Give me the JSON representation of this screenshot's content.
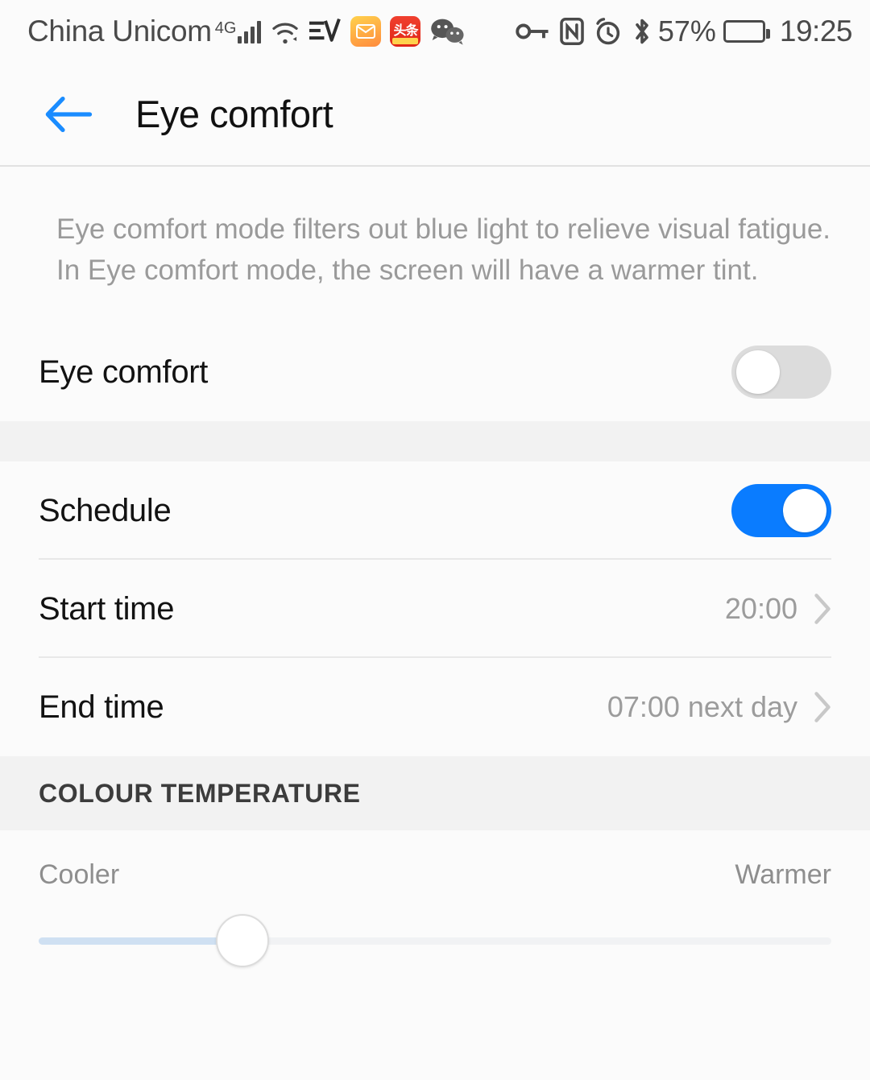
{
  "status_bar": {
    "carrier": "China Unicom",
    "network_type": "4G",
    "battery_percent": "57%",
    "time": "19:25",
    "icons": [
      "signal-bars-icon",
      "wifi-icon",
      "ev-app-icon",
      "mail-app-icon",
      "toutiao-app-icon",
      "wechat-app-icon",
      "vpn-key-icon",
      "nfc-icon",
      "alarm-clock-icon",
      "bluetooth-icon",
      "battery-icon"
    ],
    "news_icon_text": "头条"
  },
  "header": {
    "title": "Eye comfort",
    "back_icon": "back-arrow-icon",
    "accent_color": "#1A8CFF"
  },
  "description": "Eye comfort mode filters out blue light to relieve visual fatigue. In Eye comfort mode, the screen will have a warmer tint.",
  "rows": {
    "eye_comfort": {
      "label": "Eye comfort",
      "enabled": false
    },
    "schedule": {
      "label": "Schedule",
      "enabled": true
    },
    "start_time": {
      "label": "Start time",
      "value": "20:00"
    },
    "end_time": {
      "label": "End time",
      "value": "07:00 next day"
    }
  },
  "colour_temperature": {
    "section_title": "COLOUR TEMPERATURE",
    "left_label": "Cooler",
    "right_label": "Warmer",
    "slider_percent": 25.7
  },
  "colors": {
    "toggle_on": "#0A7CFF",
    "toggle_off": "#DCDCDC",
    "slider_fill": "#CFE0F2",
    "background": "#FBFBFB",
    "section_band": "#F2F2F2"
  }
}
